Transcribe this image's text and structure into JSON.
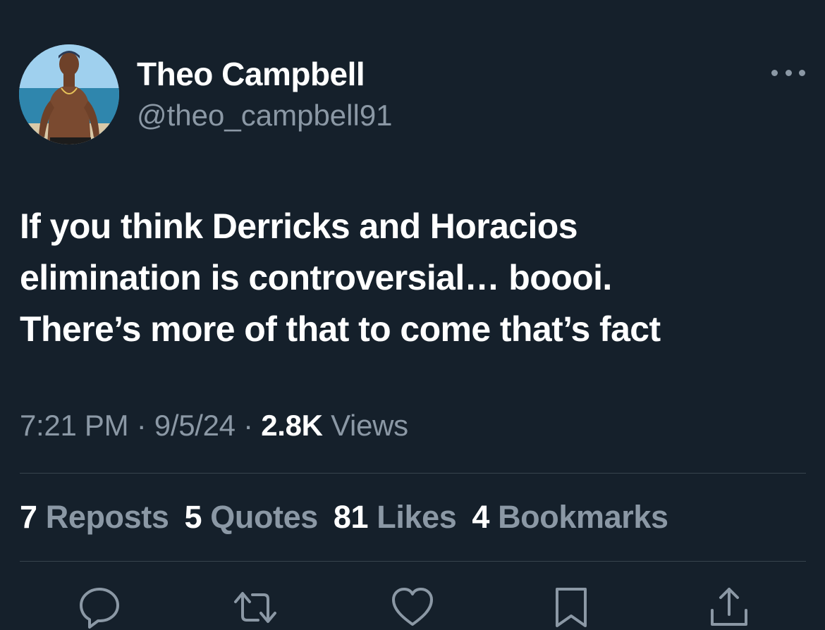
{
  "author": {
    "display_name": "Theo Campbell",
    "handle": "@theo_campbell91"
  },
  "more_icon": "more-horizontal-icon",
  "tweet": {
    "lines": [
      "If you think Derricks and Horacios",
      "elimination is controversial… boooi.",
      "There’s more of that to come that’s fact"
    ]
  },
  "meta": {
    "time": "7:21 PM",
    "separator": "·",
    "date": "9/5/24",
    "views_count": "2.8K",
    "views_label": "Views"
  },
  "stats": {
    "reposts": {
      "count": "7",
      "label": "Reposts"
    },
    "quotes": {
      "count": "5",
      "label": "Quotes"
    },
    "likes": {
      "count": "81",
      "label": "Likes"
    },
    "bookmarks": {
      "count": "4",
      "label": "Bookmarks"
    }
  },
  "actions": [
    "reply-icon",
    "repost-icon",
    "like-icon",
    "bookmark-icon",
    "share-icon"
  ],
  "colors": {
    "background": "#15202b",
    "primary_text": "#ffffff",
    "secondary_text": "#8b98a5",
    "divider": "#38444d"
  }
}
